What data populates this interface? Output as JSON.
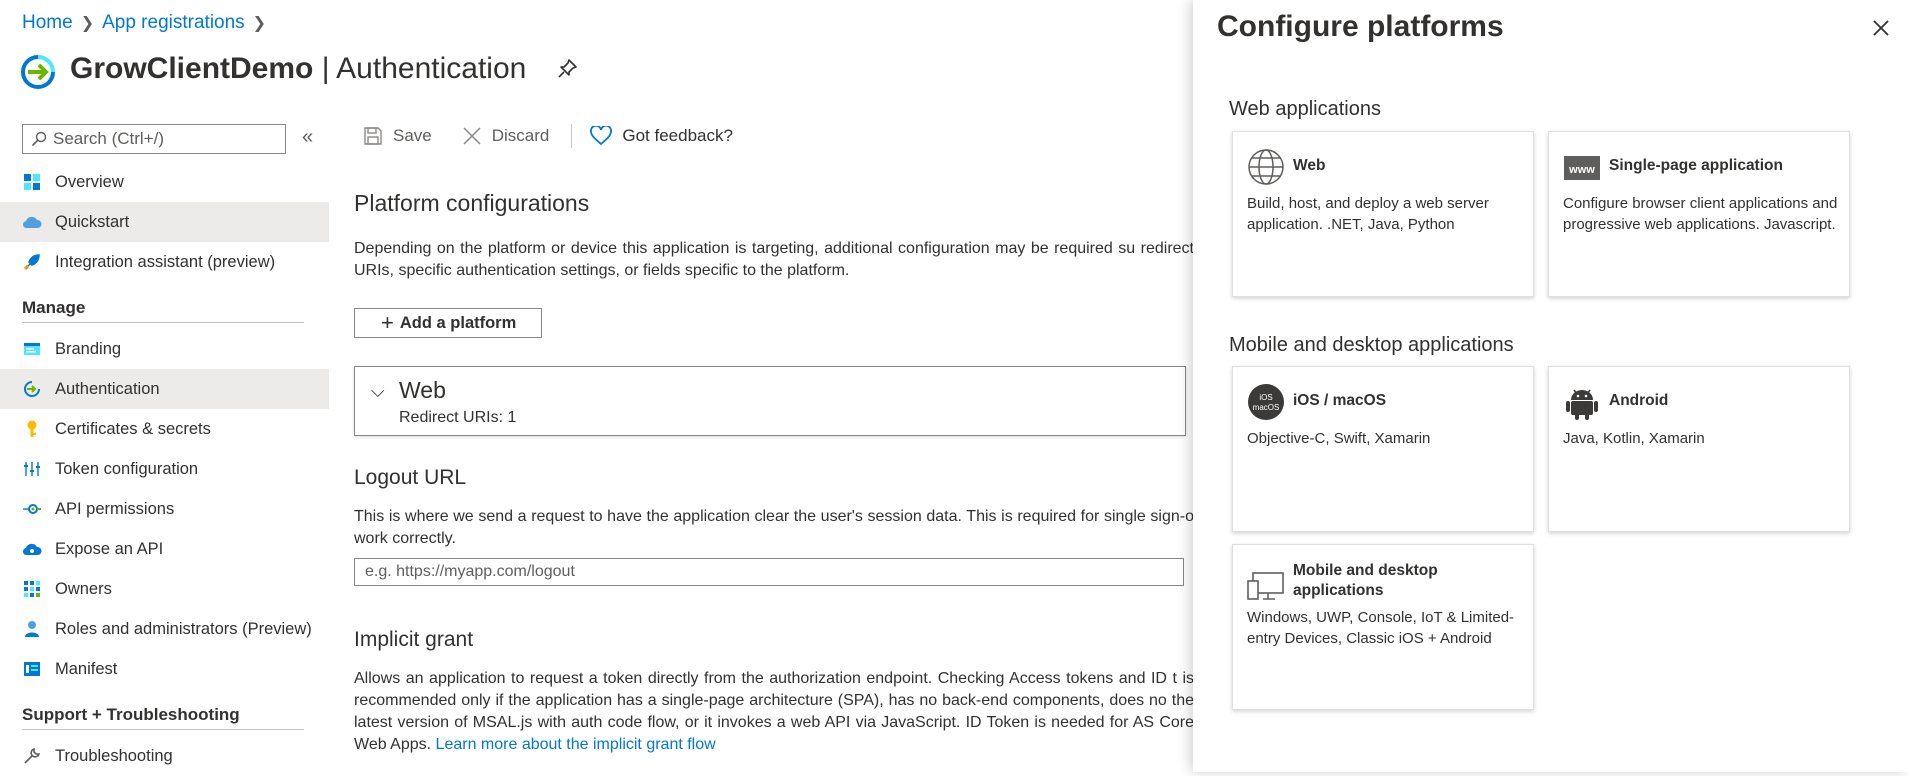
{
  "breadcrumb": {
    "home": "Home",
    "app_registrations": "App registrations"
  },
  "title": {
    "app_name": "GrowClientDemo",
    "separator": " | ",
    "section": "Authentication"
  },
  "search": {
    "placeholder": "Search (Ctrl+/)"
  },
  "sidebar": {
    "top_items": [
      {
        "label": "Overview",
        "icon": "overview-grid-icon"
      },
      {
        "label": "Quickstart",
        "icon": "cloud-icon"
      },
      {
        "label": "Integration assistant (preview)",
        "icon": "rocket-icon"
      }
    ],
    "manage_header": "Manage",
    "manage_items": [
      {
        "label": "Branding",
        "icon": "branding-icon"
      },
      {
        "label": "Authentication",
        "icon": "authentication-icon"
      },
      {
        "label": "Certificates & secrets",
        "icon": "key-icon"
      },
      {
        "label": "Token configuration",
        "icon": "token-bars-icon"
      },
      {
        "label": "API permissions",
        "icon": "api-permissions-icon"
      },
      {
        "label": "Expose an API",
        "icon": "cloud-api-icon"
      },
      {
        "label": "Owners",
        "icon": "owners-grid-icon"
      },
      {
        "label": "Roles and administrators (Preview)",
        "icon": "roles-icon"
      },
      {
        "label": "Manifest",
        "icon": "manifest-icon"
      }
    ],
    "support_header": "Support + Troubleshooting",
    "support_items": [
      {
        "label": "Troubleshooting",
        "icon": "wrench-icon"
      }
    ]
  },
  "toolbar": {
    "save": "Save",
    "discard": "Discard",
    "feedback": "Got feedback?"
  },
  "main": {
    "platform_heading": "Platform configurations",
    "platform_desc": "Depending on the platform or device this application is targeting, additional configuration may be required su redirect URIs, specific authentication settings, or fields specific to the platform.",
    "add_platform": "Add a platform",
    "web_card": {
      "title": "Web",
      "subtitle": "Redirect URIs: 1"
    },
    "logout_heading": "Logout URL",
    "logout_desc": "This is where we send a request to have the application clear the user's session data. This is required for single sign-o work correctly.",
    "logout_placeholder": "e.g. https://myapp.com/logout",
    "implicit_heading": "Implicit grant",
    "implicit_desc": "Allows an application to request a token directly from the authorization endpoint. Checking Access tokens and ID t is recommended only if the application has a single-page architecture (SPA), has no back-end components, does no the latest version of MSAL.js with auth code flow, or it invokes a web API via JavaScript. ID Token is needed for AS Core Web Apps.",
    "implicit_link": "Learn more about the implicit grant flow"
  },
  "panel": {
    "title": "Configure platforms",
    "web_group": "Web applications",
    "mobile_group": "Mobile and desktop applications",
    "tiles": {
      "web": {
        "name": "Web",
        "desc": "Build, host, and deploy a web server application. .NET, Java, Python"
      },
      "spa": {
        "name": "Single-page application",
        "desc": "Configure browser client applications and progressive web applications. Javascript.",
        "icon_text": "www"
      },
      "ios": {
        "name": "iOS / macOS",
        "desc": "Objective-C, Swift, Xamarin",
        "icon_text_1": "iOS",
        "icon_text_2": "macOS"
      },
      "android": {
        "name": "Android",
        "desc": "Java, Kotlin, Xamarin"
      },
      "desktop": {
        "name": "Mobile and desktop applications",
        "desc": "Windows, UWP, Console, IoT & Limited-entry Devices, Classic iOS + Android"
      }
    }
  },
  "colors": {
    "accent": "#0078d4",
    "selected_bg": "#edebe9",
    "text": "#323130"
  }
}
